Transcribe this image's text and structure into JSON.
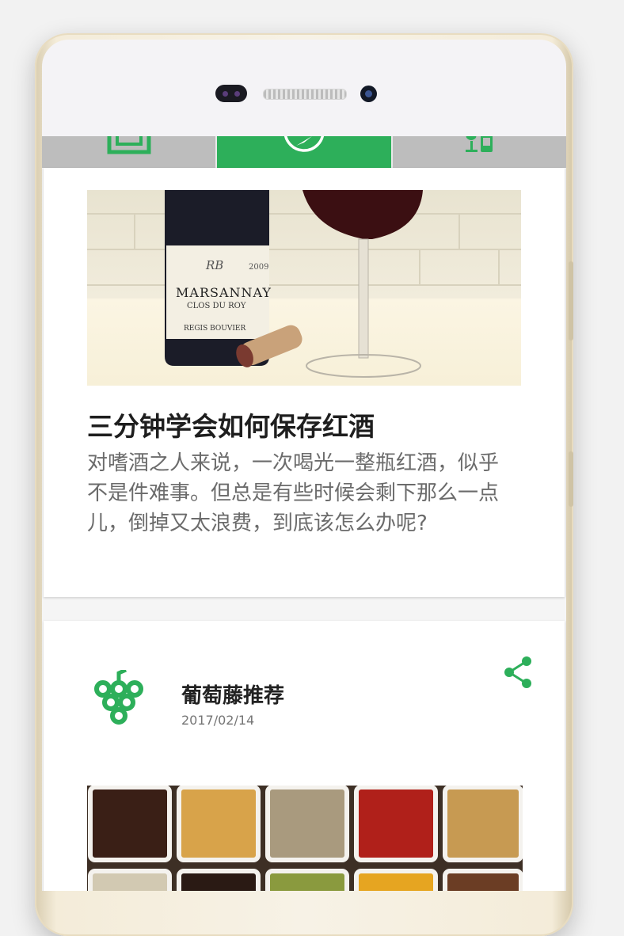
{
  "tabs": [
    {
      "icon": "photo-frame-icon",
      "active": false
    },
    {
      "icon": "compass-icon",
      "active": true
    },
    {
      "icon": "wine-glass-bottle-icon",
      "active": false
    }
  ],
  "articles": [
    {
      "image_icon": "wine-bottle-glass-photo",
      "label_top": "RB",
      "label_year": "2009",
      "label_main": "MARSANNAY",
      "label_sub": "CLOS DU ROY",
      "label_producer": "REGIS BOUVIER",
      "title": "三分钟学会如何保存红酒",
      "description": "对嗜酒之人来说，一次喝光一整瓶红酒，似乎不是件难事。但总是有些时候会剩下那么一点儿，倒掉又太浪费，到底该怎么办呢?"
    }
  ],
  "post": {
    "author": "葡萄藤推荐",
    "date": "2017/02/14",
    "avatar_icon": "grape-logo-icon",
    "share_icon": "share-icon",
    "image_icon": "spices-photo"
  },
  "colors": {
    "accent": "#2daf5a",
    "tab_bar": "#bdbdbd"
  }
}
